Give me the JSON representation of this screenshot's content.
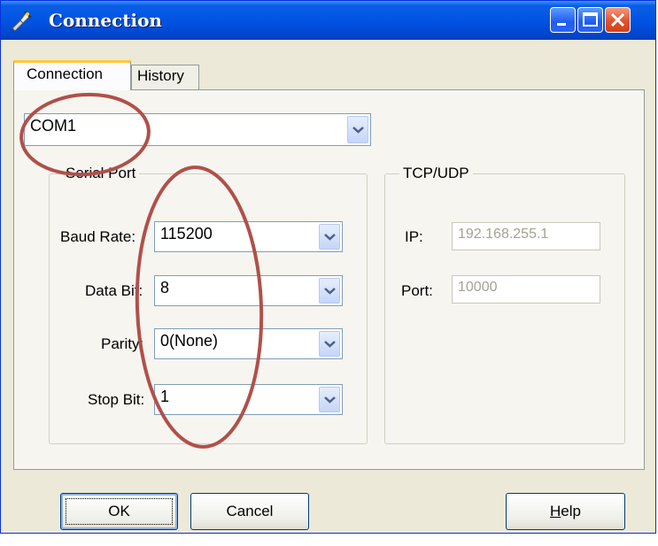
{
  "window": {
    "title": "Connection",
    "icon": "connection-app-icon",
    "controls": [
      "minimize-icon",
      "maximize-icon",
      "close-icon"
    ]
  },
  "tabs": [
    {
      "label": "Connection",
      "active": true
    },
    {
      "label": "History",
      "active": false
    }
  ],
  "port_select": {
    "value": "COM1"
  },
  "serial_port": {
    "title": "Serial Port",
    "baud_rate": {
      "label": "Baud Rate:",
      "value": "115200"
    },
    "data_bit": {
      "label": "Data Bit:",
      "value": "8"
    },
    "parity": {
      "label": "Parity:",
      "value": "0(None)"
    },
    "stop_bit": {
      "label": "Stop Bit:",
      "value": "1"
    }
  },
  "tcp_udp": {
    "title": "TCP/UDP",
    "ip": {
      "label": "IP:",
      "value": "192.168.255.1"
    },
    "port": {
      "label": "Port:",
      "value": "10000"
    }
  },
  "buttons": {
    "ok": "OK",
    "cancel": "Cancel",
    "help_mnemonic": "H",
    "help_rest": "elp"
  },
  "annotation_color": "#b0504a"
}
